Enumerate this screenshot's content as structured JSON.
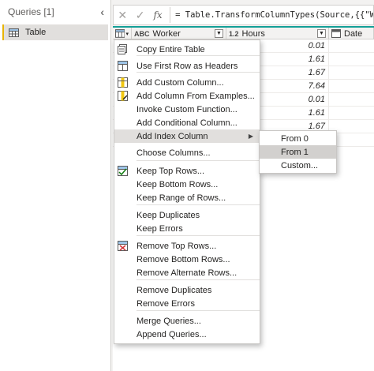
{
  "queries_pane": {
    "title": "Queries [1]",
    "items": [
      {
        "label": "Table",
        "icon": "table-icon"
      }
    ]
  },
  "formula_bar": {
    "cancel_icon": "✕",
    "confirm_icon": "✓",
    "fx_label": "fx",
    "formula": "= Table.TransformColumnTypes(Source,{{\"Worker\""
  },
  "grid": {
    "columns": [
      {
        "name": "Worker",
        "type": "ABC"
      },
      {
        "name": "Hours",
        "type": "1.2"
      },
      {
        "name": "Date",
        "type": "date"
      }
    ],
    "hours": [
      "0.01",
      "1.61",
      "1.67",
      "7.64",
      "0.01",
      "1.61",
      "1.67",
      ""
    ],
    "accent_color": "#14a098"
  },
  "menu": {
    "items": [
      {
        "label": "Copy Entire Table",
        "icon": "copy-table-icon"
      },
      {
        "label": "Use First Row as Headers",
        "icon": "headers-icon"
      },
      {
        "label": "Add Custom Column...",
        "icon": "custom-column-icon"
      },
      {
        "label": "Add Column From Examples...",
        "icon": "column-examples-icon"
      },
      {
        "label": "Invoke Custom Function..."
      },
      {
        "label": "Add Conditional Column..."
      },
      {
        "label": "Add Index Column"
      },
      {
        "label": "Choose Columns..."
      },
      {
        "label": "Keep Top Rows...",
        "icon": "keep-rows-icon"
      },
      {
        "label": "Keep Bottom Rows..."
      },
      {
        "label": "Keep Range of Rows..."
      },
      {
        "label": "Keep Duplicates"
      },
      {
        "label": "Keep Errors"
      },
      {
        "label": "Remove Top Rows...",
        "icon": "remove-rows-icon"
      },
      {
        "label": "Remove Bottom Rows..."
      },
      {
        "label": "Remove Alternate Rows..."
      },
      {
        "label": "Remove Duplicates"
      },
      {
        "label": "Remove Errors"
      },
      {
        "label": "Merge Queries..."
      },
      {
        "label": "Append Queries..."
      }
    ]
  },
  "submenu": {
    "items": [
      {
        "label": "From 0"
      },
      {
        "label": "From 1"
      },
      {
        "label": "Custom..."
      }
    ]
  }
}
